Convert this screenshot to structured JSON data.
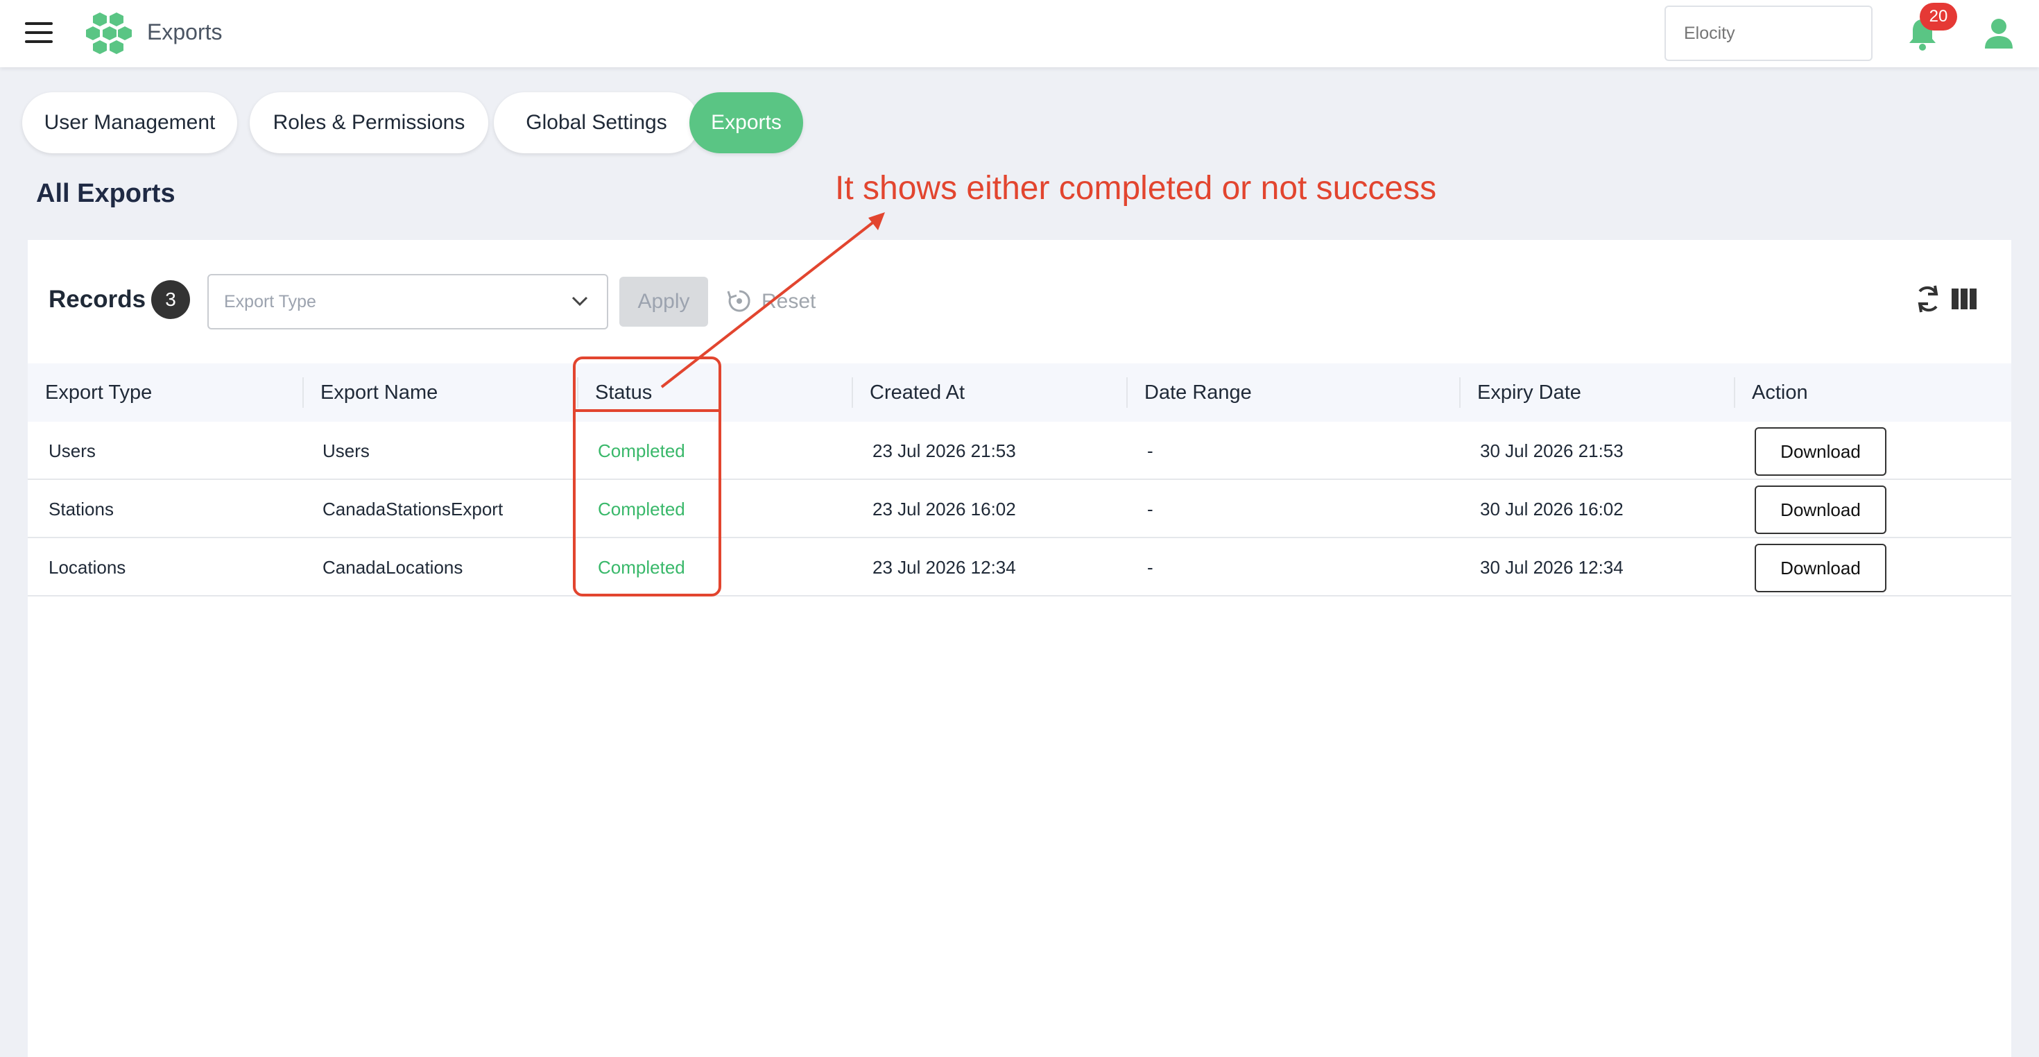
{
  "header": {
    "title": "Exports",
    "tenant_placeholder": "Elocity",
    "notification_count": "20",
    "brand_color": "#5ac584"
  },
  "tabs": [
    {
      "label": "User Management",
      "active": false
    },
    {
      "label": "Roles & Permissions",
      "active": false
    },
    {
      "label": "Global Settings",
      "active": false
    },
    {
      "label": "Exports",
      "active": true
    }
  ],
  "page": {
    "heading": "All Exports",
    "annotation": "It shows either completed or not success"
  },
  "toolbar": {
    "records_label": "Records",
    "records_count": "3",
    "filter_placeholder": "Export Type",
    "apply_label": "Apply",
    "reset_label": "Reset"
  },
  "table": {
    "columns": [
      "Export Type",
      "Export Name",
      "Status",
      "Created At",
      "Date Range",
      "Expiry Date",
      "Action"
    ],
    "rows": [
      {
        "export_type": "Users",
        "export_name": "Users",
        "status": "Completed",
        "created_at": "23 Jul 2026 21:53",
        "date_range": "-",
        "expiry_date": "30 Jul 2026 21:53",
        "action": "Download"
      },
      {
        "export_type": "Stations",
        "export_name": "CanadaStationsExport",
        "status": "Completed",
        "created_at": "23 Jul 2026 16:02",
        "date_range": "-",
        "expiry_date": "30 Jul 2026 16:02",
        "action": "Download"
      },
      {
        "export_type": "Locations",
        "export_name": "CanadaLocations",
        "status": "Completed",
        "created_at": "23 Jul 2026 12:34",
        "date_range": "-",
        "expiry_date": "30 Jul 2026 12:34",
        "action": "Download"
      }
    ]
  },
  "icons": {
    "menu": "hamburger-icon",
    "logo": "hexagon-logo-icon",
    "notifications": "bell-icon",
    "profile": "user-icon",
    "dropdown": "chevron-down-icon",
    "reset": "reset-icon",
    "refresh": "refresh-icon",
    "columns": "columns-icon"
  }
}
